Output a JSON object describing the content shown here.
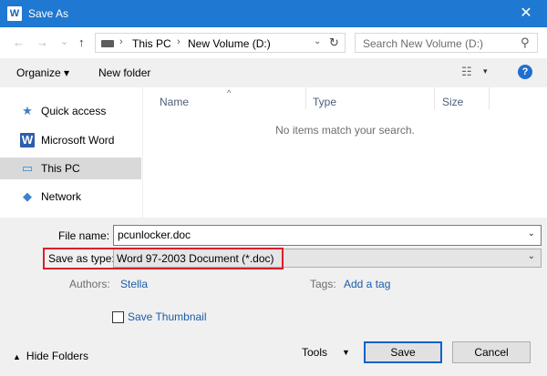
{
  "window": {
    "title": "Save As",
    "icon": "word-app-icon",
    "app_icon_letter": "W",
    "close_glyph": "✕"
  },
  "nav_buttons": {
    "back": "←",
    "forward": "→",
    "recent": "⌄",
    "up": "↑"
  },
  "address": {
    "crumbs": [
      "This PC",
      "New Volume (D:)"
    ],
    "separator": "›",
    "dropdown_glyph": "⌄",
    "refresh_glyph": "↻"
  },
  "search": {
    "placeholder": "Search New Volume (D:)",
    "icon": "search-icon",
    "glyph": "⚲"
  },
  "toolbar": {
    "organize_label": "Organize ▾",
    "new_folder_label": "New folder",
    "view_glyph": "☷",
    "view_dropdown": "▾",
    "help_glyph": "?"
  },
  "navigation": {
    "items": [
      {
        "label": "Quick access",
        "icon": "star-icon",
        "glyph": "★"
      },
      {
        "label": "Microsoft Word",
        "icon": "word-icon",
        "glyph": "W"
      },
      {
        "label": "This PC",
        "icon": "computer-icon",
        "glyph": "▭",
        "selected": true
      },
      {
        "label": "Network",
        "icon": "network-icon",
        "glyph": "◆"
      }
    ]
  },
  "file_list": {
    "columns": [
      "Name",
      "Type",
      "Size"
    ],
    "sort_glyph": "^",
    "empty_message": "No items match your search."
  },
  "form": {
    "file_name_label": "File name:",
    "file_name_value": "pcunlocker.doc",
    "save_as_type_label": "Save as type:",
    "save_as_type_value": "Word 97-2003 Document (*.doc)",
    "dropdown_glyph": "⌄",
    "authors_label": "Authors:",
    "authors_value": "Stella",
    "tags_label": "Tags:",
    "tags_value": "Add a tag",
    "thumbnail_label": "Save Thumbnail"
  },
  "footer": {
    "hide_folders_label": "Hide Folders",
    "hide_folders_caret": "▲",
    "tools_label": "Tools",
    "tools_dropdown": "▼",
    "save_label": "Save",
    "cancel_label": "Cancel"
  },
  "colors": {
    "titlebar": "#1f78d1",
    "highlight_box": "#d9202a",
    "link": "#1a5ea8"
  }
}
